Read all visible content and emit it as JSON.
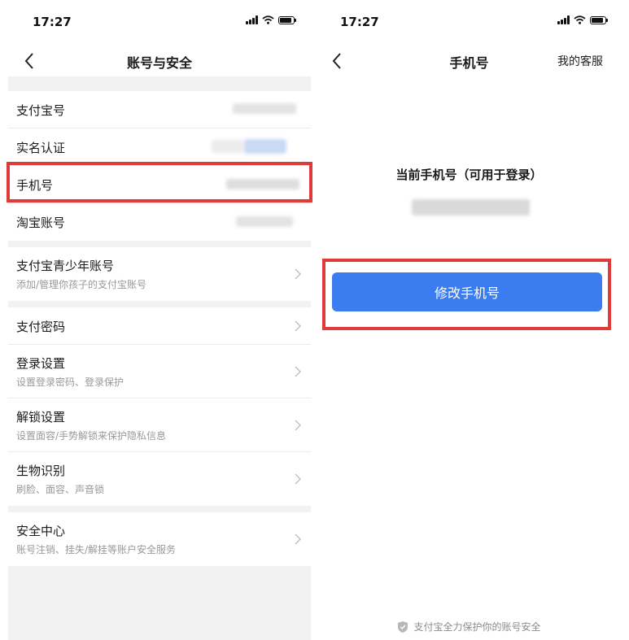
{
  "left": {
    "status": {
      "time": "17:27"
    },
    "nav": {
      "title": "账号与安全"
    },
    "rows": {
      "alipay_id": "支付宝号",
      "real_name": "实名认证",
      "phone": "手机号",
      "taobao": "淘宝账号",
      "youth": {
        "label": "支付宝青少年账号",
        "sub": "添加/管理你孩子的支付宝账号"
      },
      "pay_password": "支付密码",
      "login": {
        "label": "登录设置",
        "sub": "设置登录密码、登录保护"
      },
      "unlock": {
        "label": "解锁设置",
        "sub": "设置面容/手势解锁来保护隐私信息"
      },
      "bio": {
        "label": "生物识别",
        "sub": "刷脸、面容、声音锁"
      },
      "security": {
        "label": "安全中心",
        "sub": "账号注销、挂失/解挂等账户安全服务"
      }
    }
  },
  "right": {
    "status": {
      "time": "17:27"
    },
    "nav": {
      "title": "手机号",
      "service": "我的客服"
    },
    "current_label": "当前手机号（可用于登录）",
    "button": "修改手机号",
    "footer": "支付宝全力保护你的账号安全"
  },
  "colors": {
    "accent": "#3b7cf0",
    "highlight": "#e03b3b",
    "background": "#f2f2f2"
  },
  "icons": [
    "back-arrow-icon",
    "chevron-right-icon",
    "signal-icon",
    "wifi-icon",
    "battery-icon",
    "shield-icon"
  ]
}
